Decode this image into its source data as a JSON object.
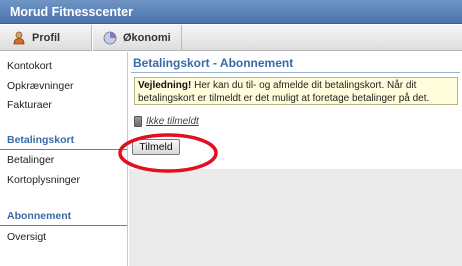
{
  "app": {
    "title": "Morud Fitnesscenter"
  },
  "tabs": [
    {
      "label": "Profil",
      "icon": "user-icon"
    },
    {
      "label": "Økonomi",
      "icon": "finance-icon"
    }
  ],
  "sidebar": {
    "items_top": [
      "Kontokort",
      "Opkrævninger",
      "Fakturaer"
    ],
    "section_betalingskort": {
      "heading": "Betalingskort",
      "items": [
        "Betalinger",
        "Kortoplysninger"
      ]
    },
    "section_abonnement": {
      "heading": "Abonnement",
      "items": [
        "Oversigt"
      ]
    }
  },
  "main": {
    "title": "Betalingskort - Abonnement",
    "guide": {
      "label": "Vejledning!",
      "text": " Her kan du til- og afmelde dit betalingskort. Når dit betalingskort er tilmeldt er det muligt at foretage betalinger på det."
    },
    "status": {
      "icon": "card-icon",
      "text": "Ikke tilmeldt"
    },
    "tilmeld_button": "Tilmeld"
  },
  "colors": {
    "titlebar": "#4a74ad",
    "heading_blue": "#3a6aa8",
    "highlight_red": "#e0101e",
    "guide_bg": "#fffddb"
  }
}
